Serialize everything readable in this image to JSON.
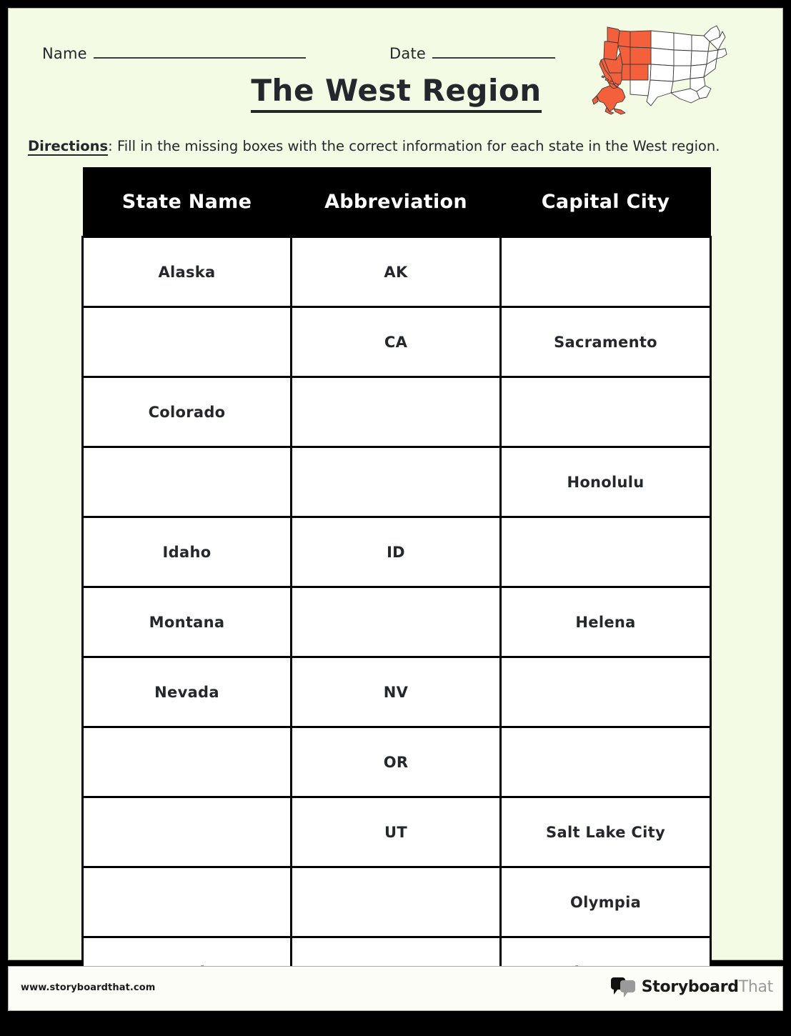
{
  "page": {
    "background_color": "#F3FBE4",
    "border_color": "#000000",
    "text_color": "#24272C"
  },
  "header": {
    "name_label": "Name",
    "date_label": "Date",
    "title": "The West Region"
  },
  "map": {
    "name": "us-map-west-region",
    "highlight_color": "#F4603C",
    "inactive_color": "#FFFFFF",
    "outline_color": "#3a3a3a",
    "highlighted_states": [
      "Alaska",
      "Washington",
      "Oregon",
      "California",
      "Nevada",
      "Idaho",
      "Montana",
      "Wyoming",
      "Utah",
      "Colorado"
    ]
  },
  "directions": {
    "label": "Directions",
    "separator": ": ",
    "text": "Fill in the missing boxes with the correct information for each state in the West region."
  },
  "table": {
    "headers": [
      "State Name",
      "Abbreviation",
      "Capital City"
    ],
    "rows": [
      {
        "state": "Alaska",
        "abbr": "AK",
        "capital": ""
      },
      {
        "state": "",
        "abbr": "CA",
        "capital": "Sacramento"
      },
      {
        "state": "Colorado",
        "abbr": "",
        "capital": ""
      },
      {
        "state": "",
        "abbr": "",
        "capital": "Honolulu"
      },
      {
        "state": "Idaho",
        "abbr": "ID",
        "capital": ""
      },
      {
        "state": "Montana",
        "abbr": "",
        "capital": "Helena"
      },
      {
        "state": "Nevada",
        "abbr": "NV",
        "capital": ""
      },
      {
        "state": "",
        "abbr": "OR",
        "capital": ""
      },
      {
        "state": "",
        "abbr": "UT",
        "capital": "Salt Lake City"
      },
      {
        "state": "",
        "abbr": "",
        "capital": "Olympia"
      },
      {
        "state": "Wyoming",
        "abbr": "",
        "capital": "Cheyenne"
      }
    ]
  },
  "footer": {
    "url": "www.storyboardthat.com",
    "logo_text_primary": "Storyboard",
    "logo_text_secondary": "That"
  }
}
